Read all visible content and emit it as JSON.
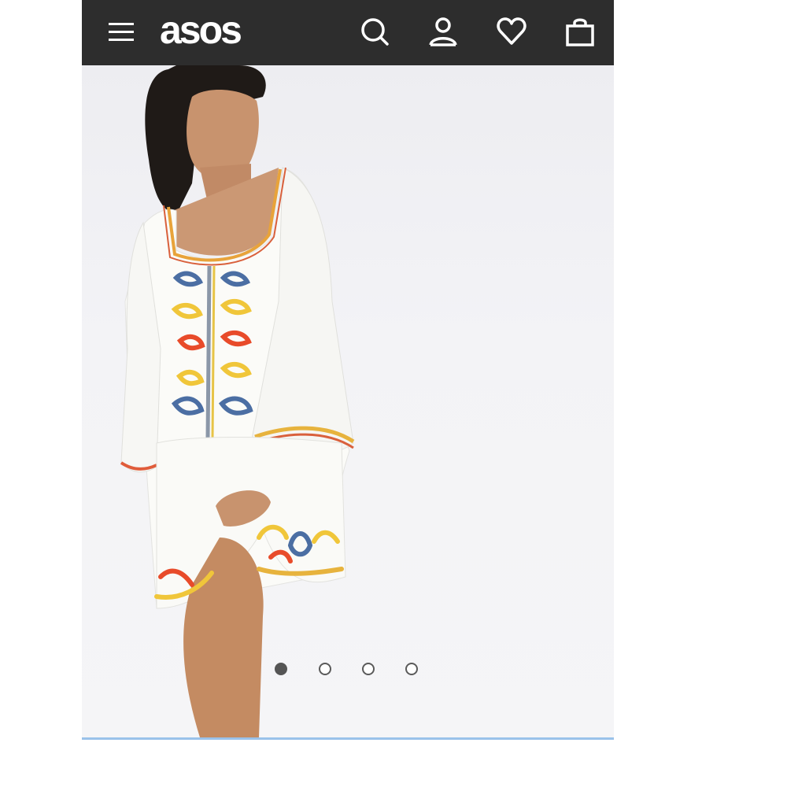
{
  "header": {
    "logo_text": "asos",
    "background_color": "#2d2d2d",
    "icons": {
      "menu": "hamburger-menu-icon",
      "search": "search-icon",
      "account": "user-icon",
      "saved": "heart-icon",
      "bag": "shopping-bag-icon"
    }
  },
  "gallery": {
    "image_count": 4,
    "active_index": 0,
    "accent_color": "#9ac2ea"
  }
}
